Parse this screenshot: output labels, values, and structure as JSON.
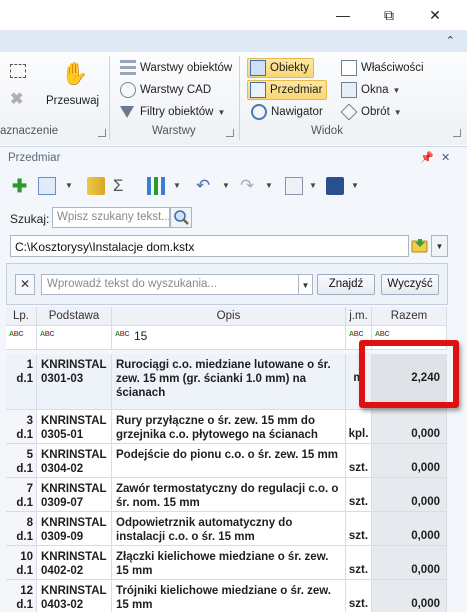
{
  "window": {
    "minimize": "—",
    "maximize": "⧉",
    "close": "✕"
  },
  "ribbon": {
    "collapse": "⌃",
    "groups": {
      "oznaczenie": {
        "label": "aznaczenie",
        "przesuwaj": "Przesuwaj"
      },
      "warstwy": {
        "label": "Warstwy",
        "items": [
          "Warstwy obiektów",
          "Warstwy CAD",
          "Filtry obiektów"
        ]
      },
      "widok": {
        "label": "Widok",
        "items": [
          "Obiekty",
          "Przedmiar",
          "Nawigator",
          "Właściwości",
          "Okna",
          "Obrót"
        ]
      }
    }
  },
  "panel": {
    "title": "Przedmiar",
    "pin": "📌",
    "close": "✕",
    "search": {
      "label": "Szukaj:",
      "placeholder": "Wpisz szukany tekst..."
    },
    "path": "C:\\Kosztorysy\\Instalacje dom.kstx",
    "filter": {
      "placeholder": "Wprowadź tekst do wyszukania...",
      "find_label": "Znajdź",
      "clear_label": "Wyczyść",
      "clear_x": "✕"
    }
  },
  "grid": {
    "columns": [
      "Lp.",
      "Podstawa",
      "Opis",
      "j.m.",
      "Razem"
    ],
    "filter_row": {
      "opis": "15"
    },
    "rows": [
      {
        "lp1": "1",
        "lp2": "d.1",
        "pod1": "KNRINSTAL",
        "pod2": "0301-03",
        "opis": "Rurociągi c.o. miedziane lutowane o śr. zew. 15 mm (gr. ścianki 1.0 mm) na ścianach",
        "jm": "m",
        "razem": "2,240"
      },
      {
        "lp1": "3",
        "lp2": "d.1",
        "pod1": "KNRINSTAL",
        "pod2": "0305-01",
        "opis": "Rury przyłączne o śr. zew. 15 mm do grzejnika c.o. płytowego na ścianach",
        "jm": "kpl.",
        "razem": "0,000"
      },
      {
        "lp1": "5",
        "lp2": "d.1",
        "pod1": "KNRINSTAL",
        "pod2": "0304-02",
        "opis": "Podejście do pionu c.o. o śr. zew. 15 mm",
        "jm": "szt.",
        "razem": "0,000"
      },
      {
        "lp1": "7",
        "lp2": "d.1",
        "pod1": "KNRINSTAL",
        "pod2": "0309-07",
        "opis": "Zawór termostatyczny do regulacji c.o. o śr. nom. 15 mm",
        "jm": "szt.",
        "razem": "0,000"
      },
      {
        "lp1": "8",
        "lp2": "d.1",
        "pod1": "KNRINSTAL",
        "pod2": "0309-09",
        "opis": "Odpowietrznik automatyczny do instalacji c.o. o śr. 15 mm",
        "jm": "szt.",
        "razem": "0,000"
      },
      {
        "lp1": "10",
        "lp2": "d.1",
        "pod1": "KNRINSTAL",
        "pod2": "0402-02",
        "opis": "Złączki kielichowe miedziane o śr. zew. 15 mm",
        "jm": "szt.",
        "razem": "0,000"
      },
      {
        "lp1": "12",
        "lp2": "d.1",
        "pod1": "KNRINSTAL",
        "pod2": "0403-02",
        "opis": "Trójniki kielichowe miedziane o śr. zew. 15 mm",
        "jm": "szt.",
        "razem": "0,000"
      }
    ]
  },
  "colors": {
    "accent_highlight": "#e01010",
    "toggle_fill": "#f9d675"
  }
}
